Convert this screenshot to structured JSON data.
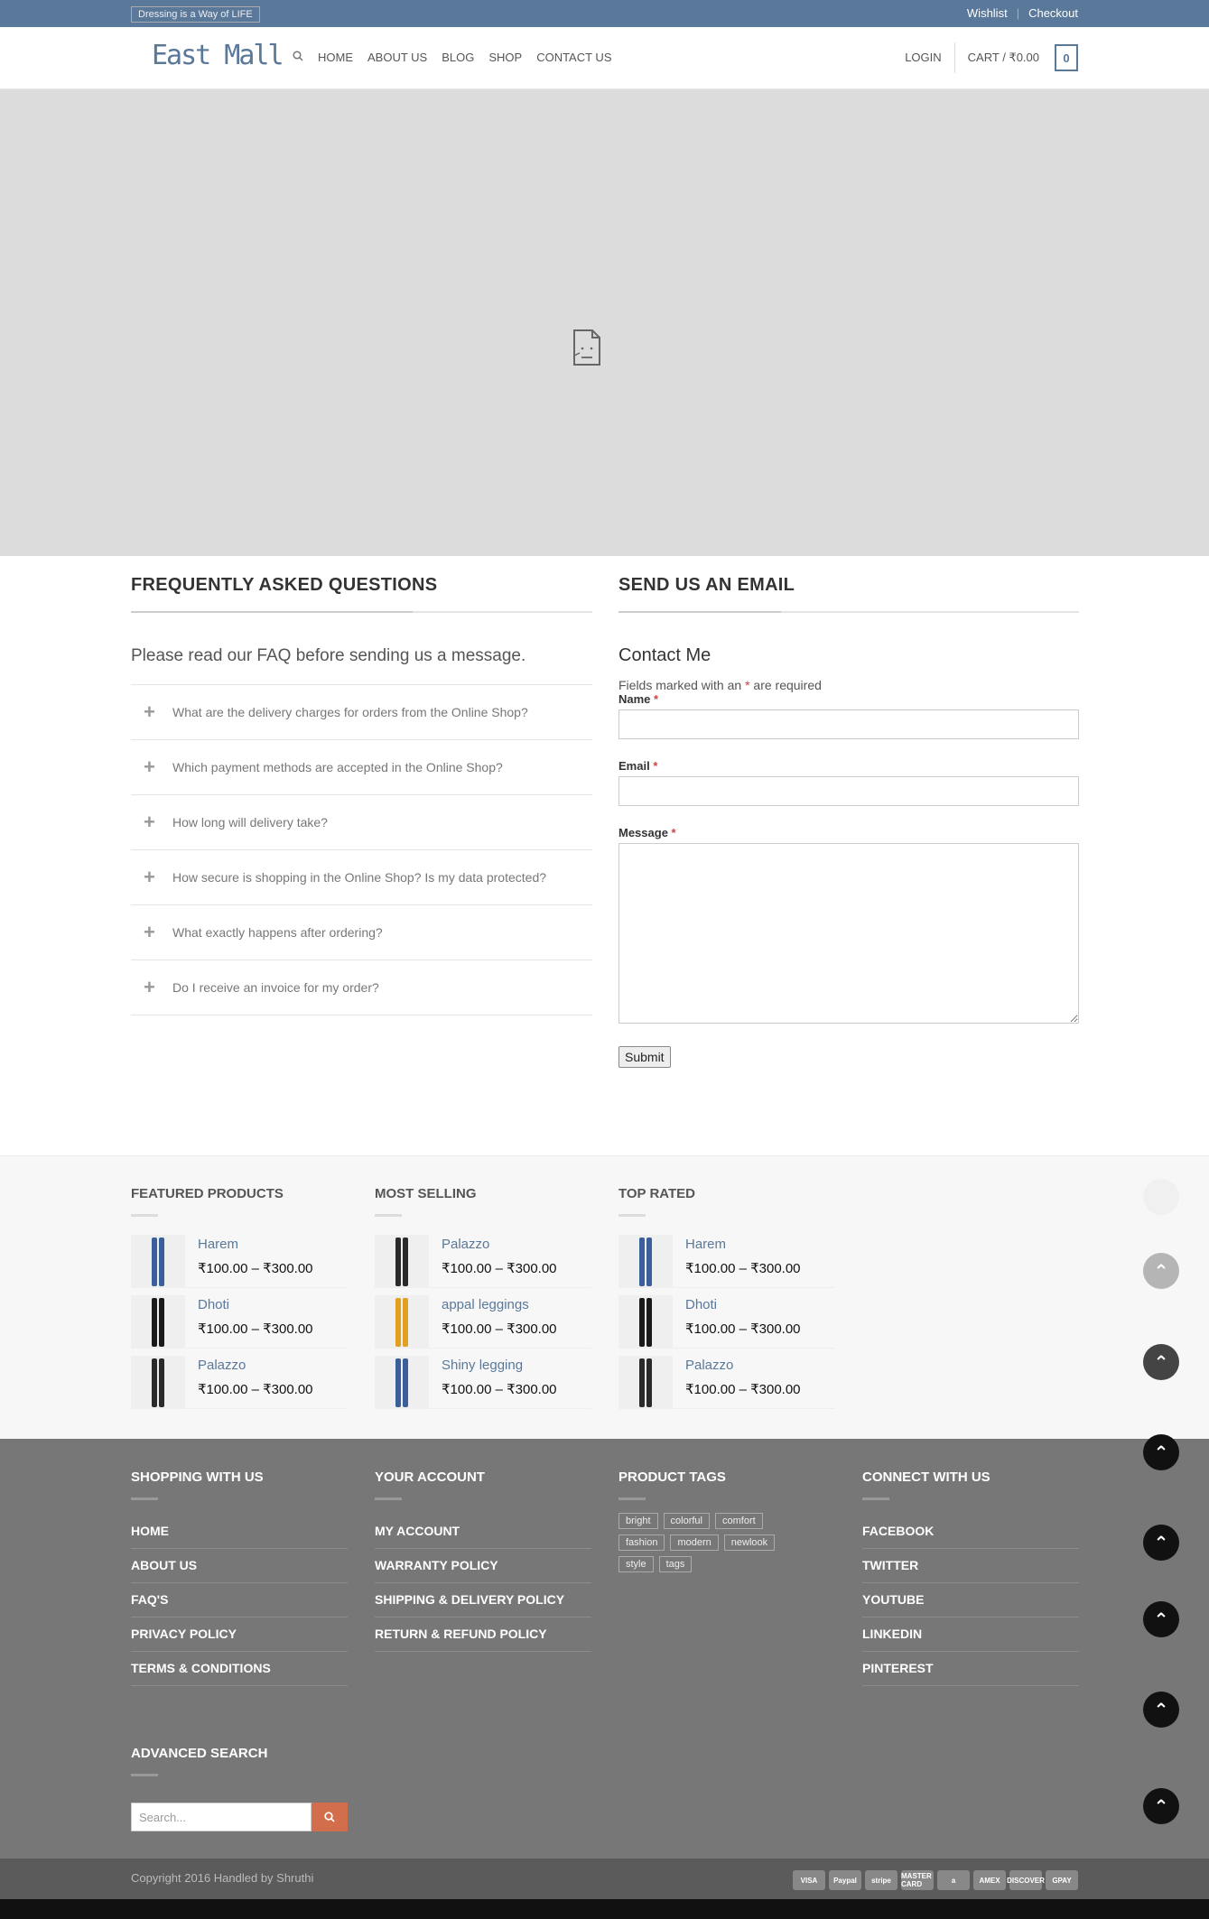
{
  "topbar": {
    "tagline": "Dressing is a Way of LIFE",
    "wishlist": "Wishlist",
    "sep": "|",
    "checkout": "Checkout"
  },
  "header": {
    "logo": "East Mall",
    "nav": [
      "HOME",
      "ABOUT US",
      "BLOG",
      "SHOP",
      "CONTACT US"
    ],
    "login": "LOGIN",
    "cart": "CART / ₹0.00",
    "cart_count": "0"
  },
  "faq": {
    "title": "FREQUENTLY ASKED QUESTIONS",
    "intro": "Please read our FAQ before sending us a message.",
    "items": [
      "What are the delivery charges for orders from the Online Shop?",
      "Which payment methods are accepted in the Online Shop?",
      "How long will delivery take?",
      "How secure is shopping in the Online Shop? Is my data protected?",
      "What exactly happens after ordering?",
      "Do I receive an invoice for my order?"
    ]
  },
  "email": {
    "title": "SEND US AN EMAIL",
    "form_title": "Contact Me",
    "required_pre": "Fields marked with an ",
    "asterisk": "*",
    "required_post": " are required",
    "name_label": "Name",
    "email_label": "Email",
    "message_label": "Message",
    "submit": "Submit"
  },
  "products": {
    "columns": [
      {
        "title": "FEATURED PRODUCTS",
        "items": [
          {
            "name": "Harem",
            "price": "₹100.00 – ₹300.00",
            "color": "#3a5f9a"
          },
          {
            "name": "Dhoti",
            "price": "₹100.00 – ₹300.00",
            "color": "#1a1a1a"
          },
          {
            "name": "Palazzo",
            "price": "₹100.00 – ₹300.00",
            "color": "#2a2a2a"
          }
        ]
      },
      {
        "title": "MOST SELLING",
        "items": [
          {
            "name": "Palazzo",
            "price": "₹100.00 – ₹300.00",
            "color": "#2a2a2a"
          },
          {
            "name": "appal leggings",
            "price": "₹100.00 – ₹300.00",
            "color": "#e0a020"
          },
          {
            "name": "Shiny legging",
            "price": "₹100.00 – ₹300.00",
            "color": "#3a5f9a"
          }
        ]
      },
      {
        "title": "TOP RATED",
        "items": [
          {
            "name": "Harem",
            "price": "₹100.00 – ₹300.00",
            "color": "#3a5f9a"
          },
          {
            "name": "Dhoti",
            "price": "₹100.00 – ₹300.00",
            "color": "#1a1a1a"
          },
          {
            "name": "Palazzo",
            "price": "₹100.00 – ₹300.00",
            "color": "#2a2a2a"
          }
        ]
      }
    ]
  },
  "footer": {
    "shopping": {
      "title": "SHOPPING WITH US",
      "links": [
        "HOME",
        "ABOUT US",
        "FAQ'S",
        "PRIVACY POLICY",
        "TERMS & CONDITIONS"
      ]
    },
    "account": {
      "title": "YOUR ACCOUNT",
      "links": [
        "MY ACCOUNT",
        "WARRANTY POLICY",
        "SHIPPING & DELIVERY POLICY",
        "RETURN & REFUND POLICY"
      ]
    },
    "tags": {
      "title": "PRODUCT TAGS",
      "items": [
        "bright",
        "colorful",
        "comfort",
        "fashion",
        "modern",
        "newlook",
        "style",
        "tags"
      ]
    },
    "connect": {
      "title": "CONNECT WITH US",
      "links": [
        "FACEBOOK",
        "TWITTER",
        "YOUTUBE",
        "LINKEDIN",
        "PINTEREST"
      ]
    },
    "search": {
      "title": "ADVANCED SEARCH",
      "placeholder": "Search..."
    }
  },
  "bottom": {
    "copyright": "Copyright 2016 Handled by Shruthi",
    "payments": [
      "VISA",
      "Paypal",
      "stripe",
      "MASTER CARD",
      "a",
      "AMEX",
      "DISCOVER",
      "GPAY"
    ]
  },
  "colors": {
    "accent": "#5a7899",
    "search_button": "#d26e4b",
    "footer_bg": "#777777"
  }
}
